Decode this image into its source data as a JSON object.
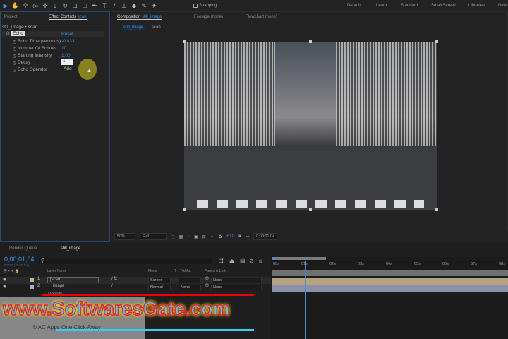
{
  "toolbar": {
    "snapping_label": "Snapping",
    "workspaces": [
      "Default",
      "Learn",
      "Standard",
      "Small Screen",
      "Libraries",
      "New"
    ]
  },
  "left_panel": {
    "tabs": [
      "Project",
      "Effect Controls"
    ],
    "active_layer": "scan",
    "breadcrumb": "still_image • scan",
    "effect": {
      "name": "Echo",
      "reset": "Reset",
      "props": [
        {
          "label": "Echo Time (seconds)",
          "value": "-0.033"
        },
        {
          "label": "Number Of Echoes",
          "value": "10"
        },
        {
          "label": "Starting Intensity",
          "value": "1.00"
        },
        {
          "label": "Decay",
          "value": "1"
        },
        {
          "label": "Echo Operator",
          "value": "Add"
        }
      ]
    }
  },
  "viewer": {
    "tab": "Composition",
    "comp_name": "still_image",
    "other_tabs": [
      "Footage (none)",
      "Flowchart (none)"
    ],
    "crumbs": [
      "still_image",
      "scan"
    ],
    "zoom": "50%",
    "resolution": "Full",
    "exposure": "+0.0",
    "timecode": "0;00;01;04"
  },
  "timeline": {
    "tabs": [
      "Render Queue",
      "still_image"
    ],
    "time": "0;00;01;04",
    "frame_info": "00028 (25.00 fps)",
    "headers": {
      "layer_name": "Layer Name",
      "mode": "Mode",
      "t": "T",
      "trkmat": "TrkMat",
      "parent": "Parent & Link"
    },
    "layers": [
      {
        "num": "1",
        "name": "[scan]",
        "mode": "Screen",
        "trkmat": "",
        "parent": "None",
        "color": "#c8b48a"
      },
      {
        "num": "2",
        "name": "image",
        "mode": "Normal",
        "trkmat": "None",
        "parent": "None",
        "color": "#a9a9d6"
      }
    ],
    "sub_prop": "Opacity",
    "ruler": [
      "00s",
      "01s",
      "02s",
      "03s",
      "04s",
      "05s",
      "06s",
      "07s",
      "08s"
    ],
    "playhead_seconds": 1.16
  },
  "watermark": {
    "url": "www.SoftwaresGate.com",
    "tagline": "MAC Apps One Click Away"
  },
  "colors": {
    "accent": "#3b8fe0",
    "bar1": "#b5a381",
    "bar2": "#8e8fa8"
  }
}
